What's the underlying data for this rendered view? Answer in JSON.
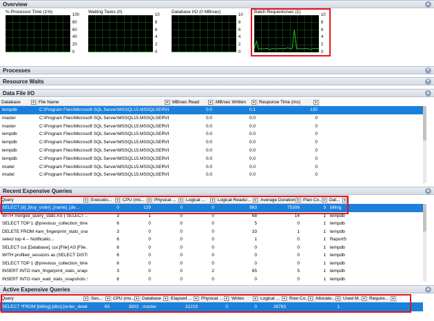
{
  "sections": {
    "overview": "Overview",
    "processes": "Processes",
    "resource_waits": "Resource Waits",
    "data_file_io": "Data File I/O",
    "recent_expensive": "Recent Expensive Queries",
    "active_expensive": "Active Expensive Queries"
  },
  "colors": {
    "accent": "#1c7fdc",
    "highlight": "#e8101a",
    "chart_line": "#22c02a"
  },
  "charts": [
    {
      "title": "% Processor Time (1%)",
      "ticks": [
        "100",
        "80",
        "60",
        "40",
        "20",
        "0"
      ],
      "values": [
        1,
        1,
        1,
        1,
        1,
        1,
        1,
        1,
        1,
        1,
        1,
        1,
        1,
        1,
        1,
        1,
        1,
        1,
        1,
        1,
        1,
        1,
        1,
        1,
        1,
        1,
        1,
        1,
        1,
        1
      ]
    },
    {
      "title": "Waiting Tasks (0)",
      "ticks": [
        "10",
        "8",
        "6",
        "4",
        "2",
        "0"
      ],
      "values": [
        0,
        0,
        0,
        0,
        0,
        0,
        0,
        0,
        0,
        0,
        0,
        0,
        0,
        0,
        0,
        0,
        0,
        0,
        0,
        0,
        0,
        0,
        0,
        0,
        0,
        0,
        0,
        0,
        0,
        0
      ]
    },
    {
      "title": "Database I/O (0 MB/sec)",
      "ticks": [
        "10",
        "8",
        "6",
        "4",
        "2",
        "0"
      ],
      "values": [
        0,
        0,
        0,
        0,
        0,
        0,
        0,
        0,
        0,
        0,
        0,
        0,
        0,
        0,
        0,
        0,
        0,
        0,
        0,
        0,
        0,
        0,
        0,
        0,
        0,
        0,
        0,
        0,
        0,
        0
      ]
    },
    {
      "title": "Batch Requests/sec (1)",
      "ticks": [
        "10",
        "8",
        "6",
        "4",
        "2",
        "0"
      ],
      "values": [
        1,
        3,
        0.8,
        1,
        0.9,
        1,
        1,
        0.8,
        1,
        1,
        0.9,
        1,
        1,
        1,
        1,
        1.2,
        1,
        1,
        6,
        1,
        1,
        0.9,
        1,
        1,
        1,
        0.8,
        1,
        1,
        1,
        1
      ]
    }
  ],
  "data_file_io": {
    "columns": [
      "Database",
      "File Name",
      "MB/sec Read",
      "MB/sec Written",
      "Response Time (ms)"
    ],
    "rows": [
      [
        "tempdb",
        "C:\\Program Files\\Microsoft SQL Server\\MSSQL15.MSSQLSERVER\\MS...",
        "0.0",
        "0.1",
        "130"
      ],
      [
        "master",
        "C:\\Program Files\\Microsoft SQL Server\\MSSQL15.MSSQLSERVER\\MS...",
        "0.0",
        "0.0",
        "0"
      ],
      [
        "master",
        "C:\\Program Files\\Microsoft SQL Server\\MSSQL15.MSSQLSERVER\\MS...",
        "0.0",
        "0.0",
        "0"
      ],
      [
        "tempdb",
        "C:\\Program Files\\Microsoft SQL Server\\MSSQL15.MSSQLSERVER\\MS...",
        "0.0",
        "0.0",
        "0"
      ],
      [
        "tempdb",
        "C:\\Program Files\\Microsoft SQL Server\\MSSQL15.MSSQLSERVER\\MS...",
        "0.0",
        "0.0",
        "0"
      ],
      [
        "tempdb",
        "C:\\Program Files\\Microsoft SQL Server\\MSSQL15.MSSQLSERVER\\MS...",
        "0.0",
        "0.0",
        "0"
      ],
      [
        "tempdb",
        "C:\\Program Files\\Microsoft SQL Server\\MSSQL15.MSSQLSERVER\\MS...",
        "0.0",
        "0.0",
        "0"
      ],
      [
        "model",
        "C:\\Program Files\\Microsoft SQL Server\\MSSQL15.MSSQLSERVER\\MS...",
        "0.0",
        "0.0",
        "0"
      ],
      [
        "model",
        "C:\\Program Files\\Microsoft SQL Server\\MSSQL15.MSSQLSERVER\\MS...",
        "0.0",
        "0.0",
        "0"
      ]
    ]
  },
  "recent_expensive": {
    "columns": [
      "Query",
      "Executio...",
      "CPU (ms...",
      "Physical ...",
      "Logical ...",
      "Logical Reads/...",
      "Average Duration ...",
      "Plan Co...",
      "Dat..."
    ],
    "rows": [
      [
        "SELECT [d]     ,[buy_order]     ,[name]     ,[de...",
        "0",
        "129",
        "0",
        "0",
        "983",
        "75306",
        "3",
        "billing"
      ],
      [
        "WITH merged_query_stats AS (   SELECT   ...",
        "3",
        "1",
        "0",
        "0",
        "68",
        "14",
        "1",
        "tempdb"
      ],
      [
        "SELECT TOP 1 @previous_collection_time = c...",
        "6",
        "0",
        "0",
        "0",
        "5",
        "0",
        "1",
        "tempdb"
      ],
      [
        "DELETE FROM #am_fingerprint_stats_snapsh...",
        "3",
        "0",
        "0",
        "0",
        "33",
        "1",
        "1",
        "tempdb"
      ],
      [
        "select top 4                    -- Notificatio...",
        "6",
        "0",
        "0",
        "0",
        "1",
        "0",
        "1",
        "ReportS..."
      ],
      [
        "SELECT     cur.[Database],     cur.[File] AS [File...",
        "6",
        "0",
        "0",
        "0",
        "0",
        "0",
        "1",
        "tempdb"
      ],
      [
        "WITH profiled_sessions as (SELECT DISTINC...",
        "6",
        "0",
        "0",
        "0",
        "0",
        "0",
        "1",
        "tempdb"
      ],
      [
        "SELECT TOP 1 @previous_collection_time = c...",
        "6",
        "0",
        "0",
        "0",
        "0",
        "0",
        "1",
        "tempdb"
      ],
      [
        "INSERT INTO #am_fingerprint_stats_snapshot...",
        "3",
        "0",
        "0",
        "2",
        "65",
        "5",
        "1",
        "tempdb"
      ],
      [
        "INSERT INTO #am_wait_stats_snapshots SEL...",
        "6",
        "0",
        "0",
        "0",
        "0",
        "0",
        "1",
        "tempdb"
      ]
    ]
  },
  "active_expensive": {
    "columns": [
      "Query",
      "Ses...",
      "CPU (ms...",
      "Database",
      "Elapsed ...",
      "Physical ...",
      "Writes",
      "Logical ...",
      "Row Co...",
      "Allocate...",
      "Used M...",
      "Require..."
    ],
    "rows": [
      [
        "SELECT *FROM [billing].[dbo].[order_details]",
        "63",
        "3803",
        "master",
        "31219",
        "0",
        "0",
        "28783",
        "",
        "1",
        "",
        ""
      ]
    ]
  }
}
